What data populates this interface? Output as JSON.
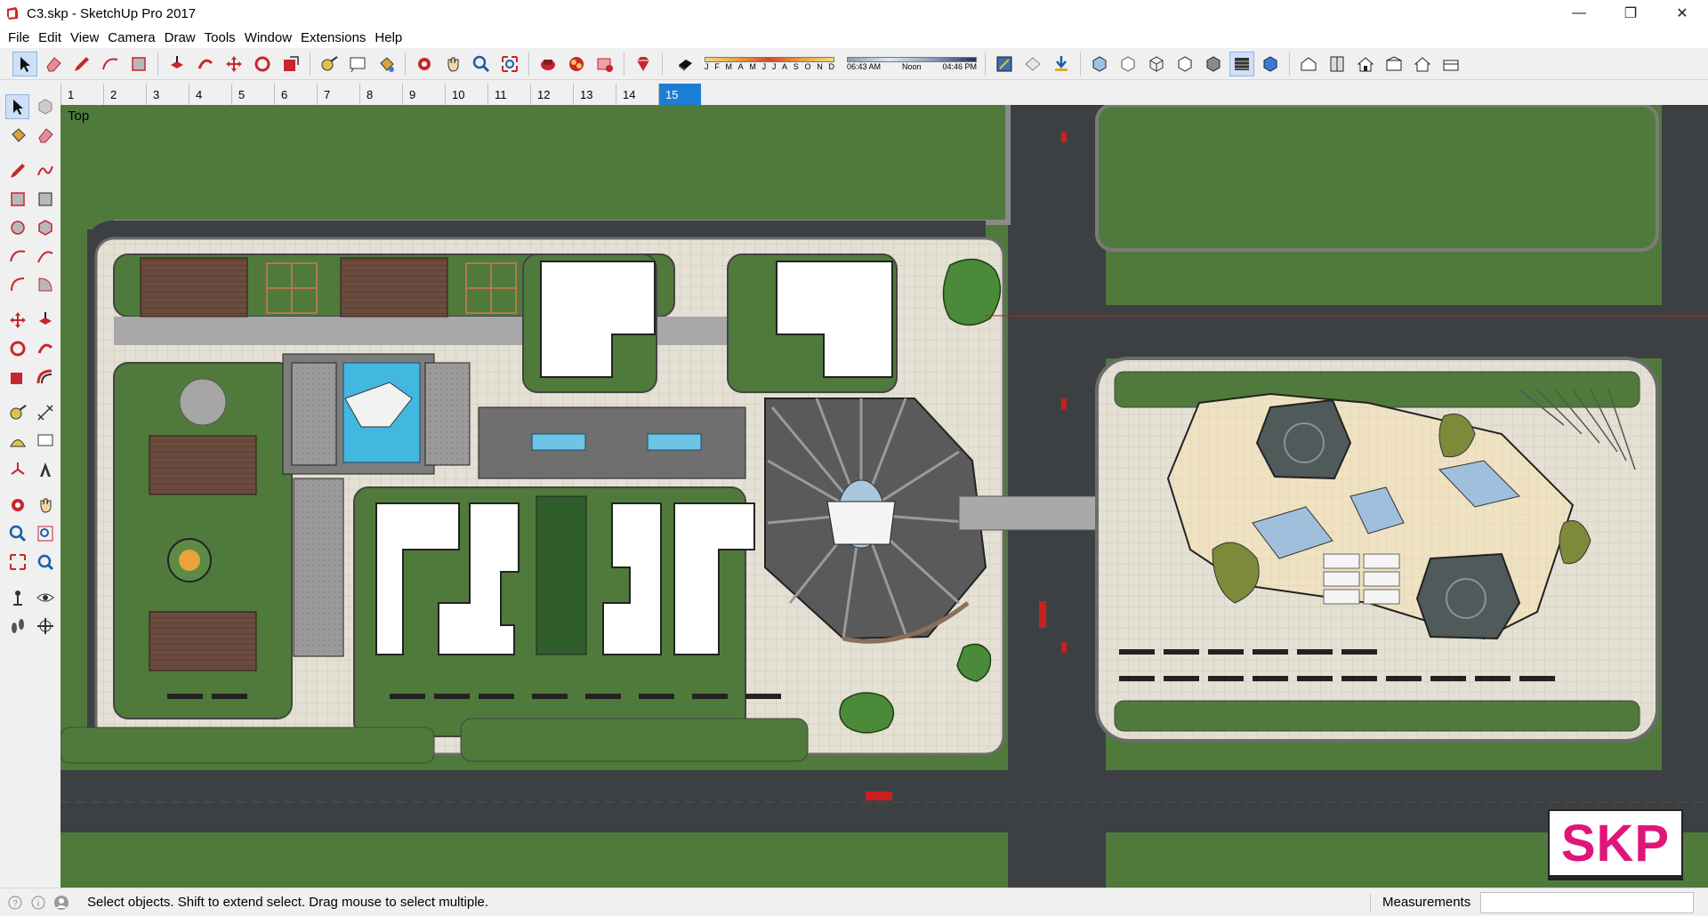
{
  "window": {
    "title": "C3.skp - SketchUp Pro 2017",
    "minimize_glyph": "—",
    "maximize_glyph": "❐",
    "close_glyph": "✕"
  },
  "menu": {
    "items": [
      "File",
      "Edit",
      "View",
      "Camera",
      "Draw",
      "Tools",
      "Window",
      "Extensions",
      "Help"
    ]
  },
  "toolbar": {
    "months": [
      "J",
      "F",
      "M",
      "A",
      "M",
      "J",
      "J",
      "A",
      "S",
      "O",
      "N",
      "D"
    ],
    "time_start": "06:43 AM",
    "time_mid": "Noon",
    "time_end": "04:46 PM"
  },
  "scenes": {
    "tabs": [
      "1",
      "2",
      "3",
      "4",
      "5",
      "6",
      "7",
      "8",
      "9",
      "10",
      "11",
      "12",
      "13",
      "14",
      "15"
    ],
    "active": "15"
  },
  "viewport": {
    "view_label": "Top",
    "watermark": "SKP"
  },
  "status": {
    "hint": "Select objects. Shift to extend select. Drag mouse to select multiple.",
    "measurements_label": "Measurements",
    "measurements_value": ""
  },
  "colors": {
    "grass": "#4f7a3c",
    "road": "#3d4043",
    "paving": "#e6e2d6",
    "accent": "#1e7ed6",
    "watermark": "#e0157a"
  }
}
